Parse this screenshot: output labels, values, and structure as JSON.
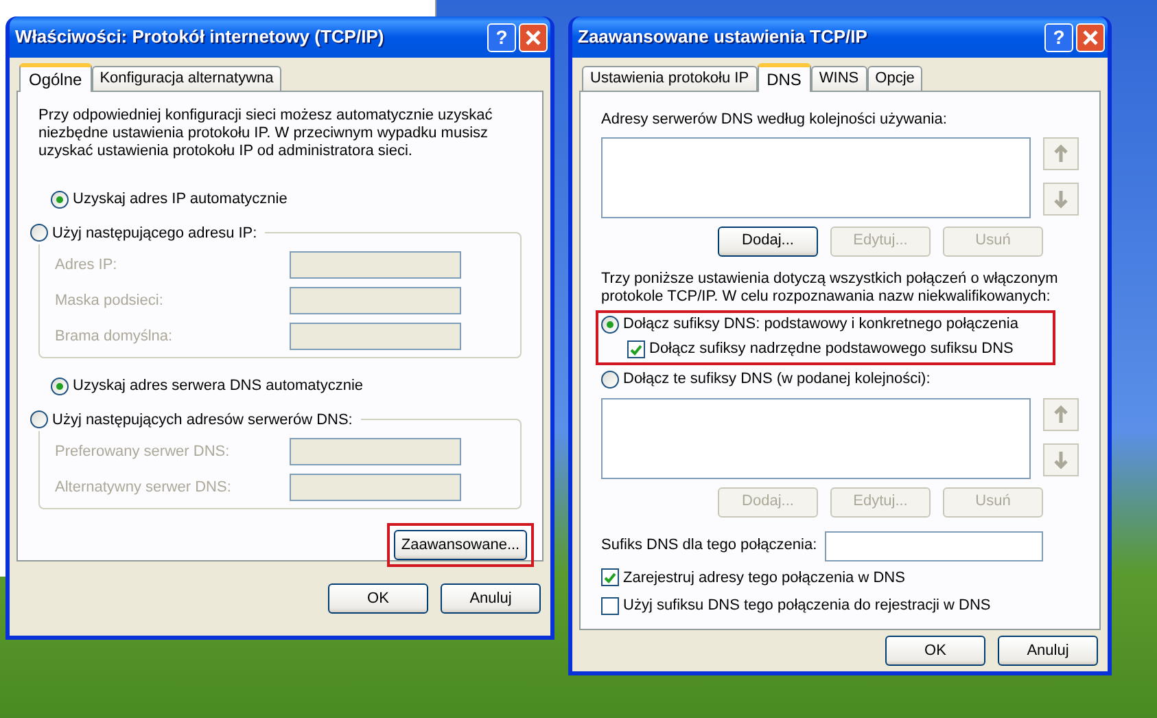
{
  "left_window": {
    "title": "Właściwości: Protokół internetowy (TCP/IP)",
    "help": "?",
    "tabs": [
      {
        "label": "Ogólne",
        "selected": true
      },
      {
        "label": "Konfiguracja alternatywna",
        "selected": false
      }
    ],
    "description": "Przy odpowiedniej konfiguracji sieci możesz automatycznie uzyskać niezbędne ustawienia protokołu IP. W przeciwnym wypadku musisz uzyskać ustawienia protokołu IP od administratora sieci.",
    "ip_options": [
      {
        "label": "Uzyskaj adres IP automatycznie",
        "selected": true
      },
      {
        "label": "Użyj następującego adresu IP:",
        "selected": false
      }
    ],
    "ip_fields": [
      {
        "label": "Adres IP:",
        "disabled": true
      },
      {
        "label": "Maska podsieci:",
        "disabled": true
      },
      {
        "label": "Brama domyślna:",
        "disabled": true
      }
    ],
    "dns_options": [
      {
        "label": "Uzyskaj adres serwera DNS automatycznie",
        "selected": true
      },
      {
        "label": "Użyj następujących adresów serwerów DNS:",
        "selected": false
      }
    ],
    "dns_fields": [
      {
        "label": "Preferowany serwer DNS:",
        "disabled": true
      },
      {
        "label": "Alternatywny serwer DNS:",
        "disabled": true
      }
    ],
    "advanced_button": {
      "label": "Zaawansowane...",
      "highlighted": true
    },
    "buttons": [
      "OK",
      "Anuluj"
    ]
  },
  "right_window": {
    "title": "Zaawansowane ustawienia TCP/IP",
    "help": "?",
    "tabs": [
      {
        "label": "Ustawienia protokołu IP",
        "selected": false
      },
      {
        "label": "DNS",
        "selected": true
      },
      {
        "label": "WINS",
        "selected": false
      },
      {
        "label": "Opcje",
        "selected": false
      }
    ],
    "servers_label": "Adresy serwerów DNS według kolejności używania:",
    "server_buttons": [
      {
        "label": "Dodaj...",
        "disabled": false
      },
      {
        "label": "Edytuj...",
        "disabled": true
      },
      {
        "label": "Usuń",
        "disabled": true
      }
    ],
    "info": "Trzy poniższe ustawienia dotyczą wszystkich połączeń o włączonym protokole TCP/IP. W celu rozpoznawania nazw niekwalifikowanych:",
    "suffix_options": [
      {
        "kind": "radio",
        "label": "Dołącz sufiksy DNS: podstawowy i konkretnego połączenia",
        "selected": true,
        "highlighted": true
      },
      {
        "kind": "checkbox",
        "label": "Dołącz sufiksy nadrzędne podstawowego sufiksu DNS",
        "checked": true,
        "highlighted": true
      },
      {
        "kind": "radio",
        "label": "Dołącz te sufiksy DNS (w podanej kolejności):",
        "selected": false,
        "highlighted": false
      }
    ],
    "suffix_buttons": [
      {
        "label": "Dodaj...",
        "disabled": true
      },
      {
        "label": "Edytuj...",
        "disabled": true
      },
      {
        "label": "Usuń",
        "disabled": true
      }
    ],
    "connection_suffix_label": "Sufiks DNS dla tego połączenia:",
    "register_options": [
      {
        "label": "Zarejestruj adresy tego połączenia w DNS",
        "checked": true
      },
      {
        "label": "Użyj sufiksu DNS tego połączenia do rejestracji w DNS",
        "checked": false
      }
    ],
    "buttons": [
      "OK",
      "Anuluj"
    ]
  }
}
